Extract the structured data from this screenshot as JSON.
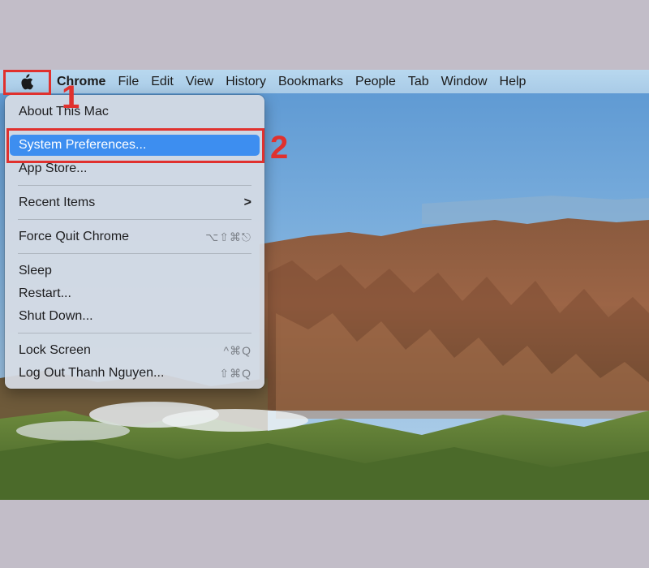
{
  "menubar": {
    "apple_icon": "apple-logo-icon",
    "items": [
      "Chrome",
      "File",
      "Edit",
      "View",
      "History",
      "Bookmarks",
      "People",
      "Tab",
      "Window",
      "Help"
    ]
  },
  "apple_menu": {
    "about": "About This Mac",
    "system_preferences": "System Preferences...",
    "app_store": "App Store...",
    "recent_items": "Recent Items",
    "recent_items_chevron": ">",
    "force_quit": "Force Quit Chrome",
    "force_quit_shortcut": "⌥⇧⌘⎋",
    "sleep": "Sleep",
    "restart": "Restart...",
    "shut_down": "Shut Down...",
    "lock_screen": "Lock Screen",
    "lock_screen_shortcut": "^⌘Q",
    "log_out": "Log Out Thanh Nguyen...",
    "log_out_shortcut": "⇧⌘Q"
  },
  "annotations": {
    "step_1": "1",
    "step_2": "2",
    "color": "#e0312e"
  },
  "colors": {
    "selection": "#3d8ef0",
    "menubar": "#b0d0ea"
  }
}
